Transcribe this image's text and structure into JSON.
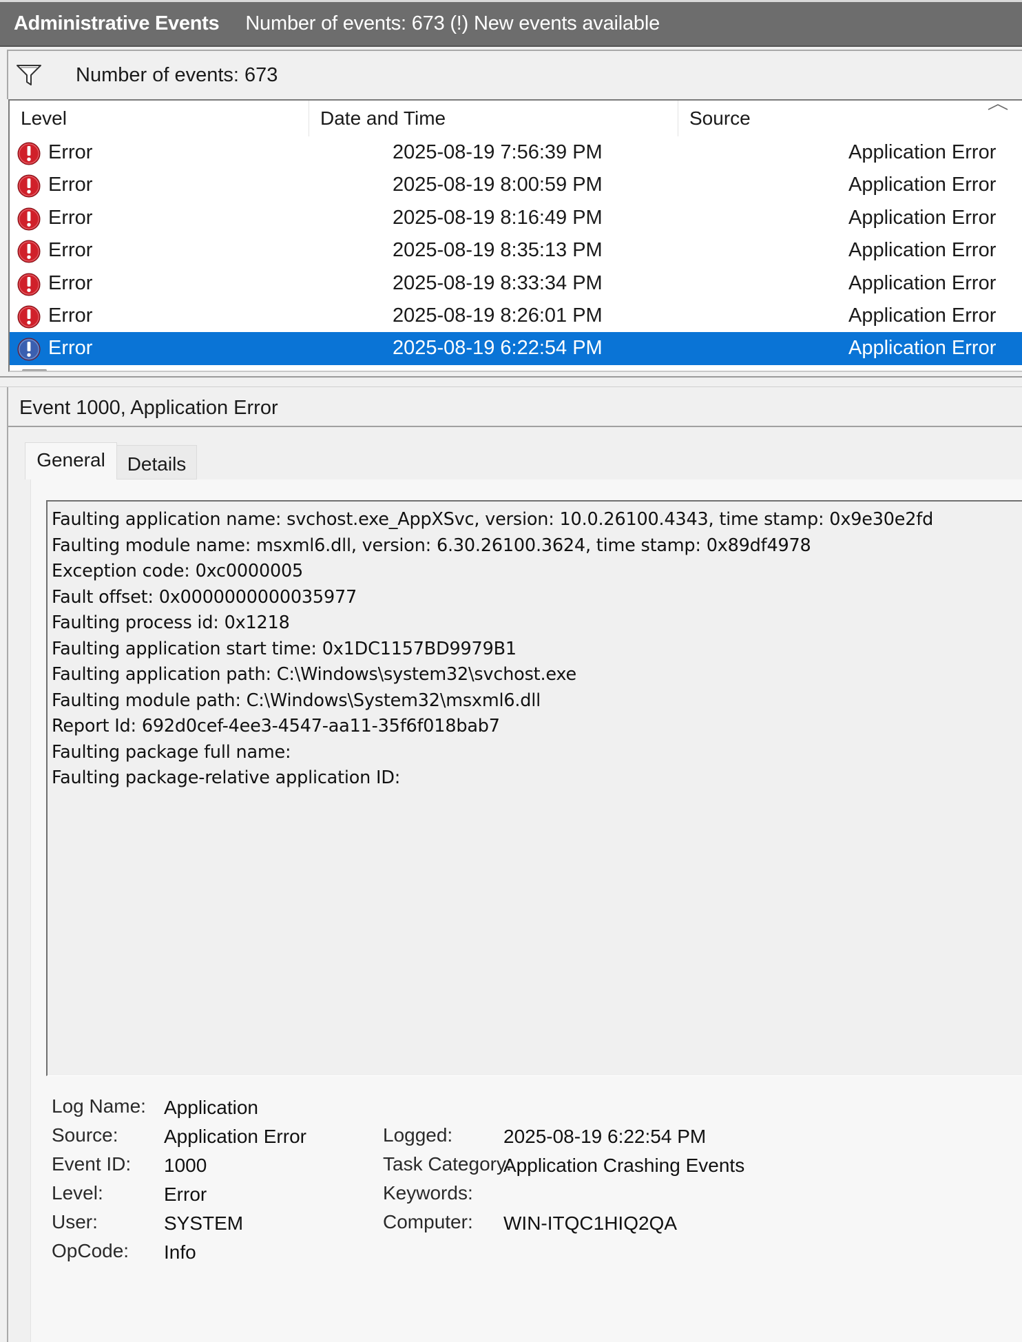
{
  "titlebar": {
    "title": "Administrative Events",
    "subtitle": "Number of events: 673 (!) New events available"
  },
  "filterbar": {
    "count": "Number of events: 673"
  },
  "grid": {
    "columns": [
      "Level",
      "Date and Time",
      "Source"
    ],
    "rows": [
      {
        "level": "Error",
        "datetime": "2025-08-19 7:56:39 PM",
        "source": "Application Error"
      },
      {
        "level": "Error",
        "datetime": "2025-08-19 8:00:59 PM",
        "source": "Application Error"
      },
      {
        "level": "Error",
        "datetime": "2025-08-19 8:16:49 PM",
        "source": "Application Error"
      },
      {
        "level": "Error",
        "datetime": "2025-08-19 8:35:13 PM",
        "source": "Application Error"
      },
      {
        "level": "Error",
        "datetime": "2025-08-19 8:33:34 PM",
        "source": "Application Error"
      },
      {
        "level": "Error",
        "datetime": "2025-08-19 8:26:01 PM",
        "source": "Application Error"
      },
      {
        "level": "Error",
        "datetime": "2025-08-19 6:22:54 PM",
        "source": "Application Error"
      }
    ],
    "selected_index": 6
  },
  "detail": {
    "title": "Event 1000, Application Error",
    "tabs": [
      "General",
      "Details"
    ],
    "description": [
      "Faulting application name: svchost.exe_AppXSvc, version: 10.0.26100.4343, time stamp: 0x9e30e2fd",
      "Faulting module name: msxml6.dll, version: 6.30.26100.3624, time stamp: 0x89df4978",
      "Exception code: 0xc0000005",
      "Fault offset: 0x0000000000035977",
      "Faulting process id: 0x1218",
      "Faulting application start time: 0x1DC1157BD9979B1",
      "Faulting application path: C:\\Windows\\system32\\svchost.exe",
      "Faulting module path: C:\\Windows\\System32\\msxml6.dll",
      "Report Id: 692d0cef-4ee3-4547-aa11-35f6f018bab7",
      "Faulting package full name: ",
      "Faulting package-relative application ID: "
    ],
    "props": {
      "log_name_label": "Log Name:",
      "log_name": "Application",
      "source_label": "Source:",
      "source": "Application Error",
      "logged_label": "Logged:",
      "logged": "2025-08-19 6:22:54 PM",
      "event_id_label": "Event ID:",
      "event_id": "1000",
      "task_category_label": "Task Category:",
      "task_category": "Application Crashing Events",
      "level_label": "Level:",
      "level": "Error",
      "keywords_label": "Keywords:",
      "keywords": "",
      "user_label": "User:",
      "user": "SYSTEM",
      "computer_label": "Computer:",
      "computer": "WIN-ITQC1HIQ2QA",
      "opcode_label": "OpCode:",
      "opcode": "Info"
    }
  },
  "colors": {
    "titlebar_bg": "#6d6d6d",
    "selection_bg": "#0a74d6",
    "error_icon": "#d0202a",
    "selected_icon": "#3a5fb0"
  },
  "icons": {
    "filter": "filter-funnel-icon",
    "error": "error-exclamation-icon",
    "sort": "sort-caret-up-icon"
  }
}
